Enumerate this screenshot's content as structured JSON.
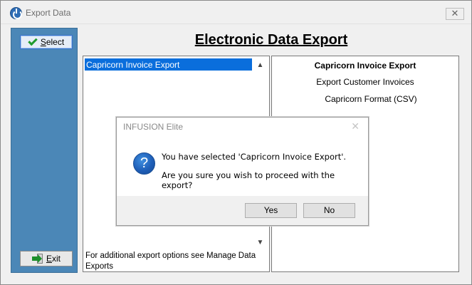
{
  "window": {
    "title": "Export Data",
    "close_glyph": "✕"
  },
  "sidebar": {
    "select_prefix": "S",
    "select_rest": "elect",
    "exit_prefix": "E",
    "exit_rest": "xit"
  },
  "main": {
    "heading": "Electronic Data Export",
    "list": {
      "selected_item": "Capricorn Invoice Export",
      "footer": "For additional export options see Manage Data Exports"
    },
    "info": {
      "title": "Capricorn Invoice Export",
      "line1": "Export Customer Invoices",
      "line2": "Capricorn Format (CSV)"
    }
  },
  "dialog": {
    "title": "INFUSION Elite",
    "close_glyph": "✕",
    "icon_glyph": "?",
    "message1": "You have selected 'Capricorn Invoice Export'.",
    "message2": "Are you sure you wish to proceed with the export?",
    "yes_label": "Yes",
    "no_label": "No"
  },
  "colors": {
    "sidebar": "#4b87b7",
    "selection": "#0a6edc",
    "accent": "#1f5fb8"
  },
  "icons": {
    "app": "power-icon",
    "select": "checkmark-icon",
    "exit": "exit-door-icon",
    "question": "question-icon"
  }
}
